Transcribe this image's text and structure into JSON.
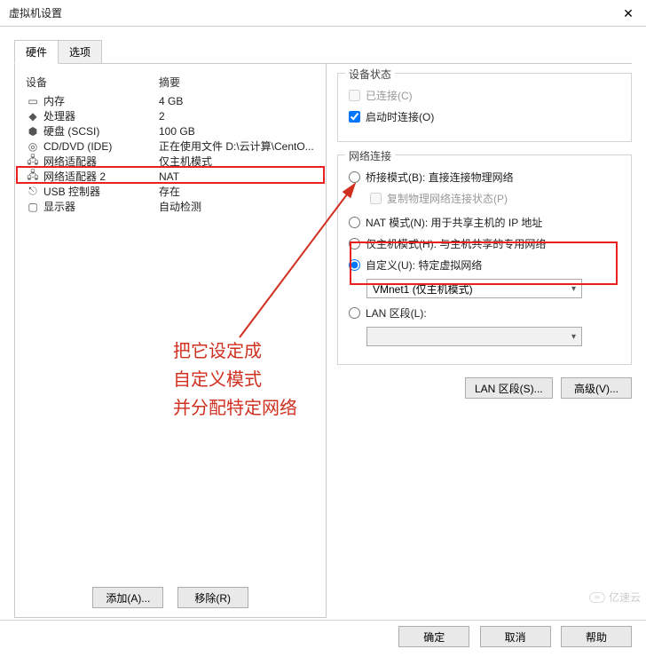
{
  "window": {
    "title": "虚拟机设置"
  },
  "tabs": {
    "hardware": "硬件",
    "options": "选项"
  },
  "table": {
    "header_device": "设备",
    "header_summary": "摘要",
    "rows": [
      {
        "name": "内存",
        "summary": "4 GB",
        "icon": "memory"
      },
      {
        "name": "处理器",
        "summary": "2",
        "icon": "cpu"
      },
      {
        "name": "硬盘 (SCSI)",
        "summary": "100 GB",
        "icon": "disk"
      },
      {
        "name": "CD/DVD (IDE)",
        "summary": "正在使用文件 D:\\云计算\\CentO...",
        "icon": "cd"
      },
      {
        "name": "网络适配器",
        "summary": "仅主机模式",
        "icon": "net"
      },
      {
        "name": "网络适配器 2",
        "summary": "NAT",
        "icon": "net"
      },
      {
        "name": "USB 控制器",
        "summary": "存在",
        "icon": "usb"
      },
      {
        "name": "显示器",
        "summary": "自动检测",
        "icon": "display"
      }
    ]
  },
  "device_status": {
    "title": "设备状态",
    "connected": "已连接(C)",
    "connect_at_poweron": "启动时连接(O)"
  },
  "network": {
    "title": "网络连接",
    "bridged": "桥接模式(B): 直接连接物理网络",
    "replicate": "复制物理网络连接状态(P)",
    "nat": "NAT 模式(N): 用于共享主机的 IP 地址",
    "hostonly": "仅主机模式(H): 与主机共享的专用网络",
    "custom": "自定义(U): 特定虚拟网络",
    "custom_value": "VMnet1 (仅主机模式)",
    "lan": "LAN 区段(L):",
    "lan_value": ""
  },
  "buttons": {
    "lan_segments": "LAN 区段(S)...",
    "advanced": "高级(V)...",
    "add": "添加(A)...",
    "remove": "移除(R)",
    "ok": "确定",
    "cancel": "取消",
    "help": "帮助"
  },
  "annotation": {
    "line1": "把它设定成",
    "line2": "自定义模式",
    "line3": "并分配特定网络"
  },
  "watermark": {
    "text": "亿速云"
  }
}
